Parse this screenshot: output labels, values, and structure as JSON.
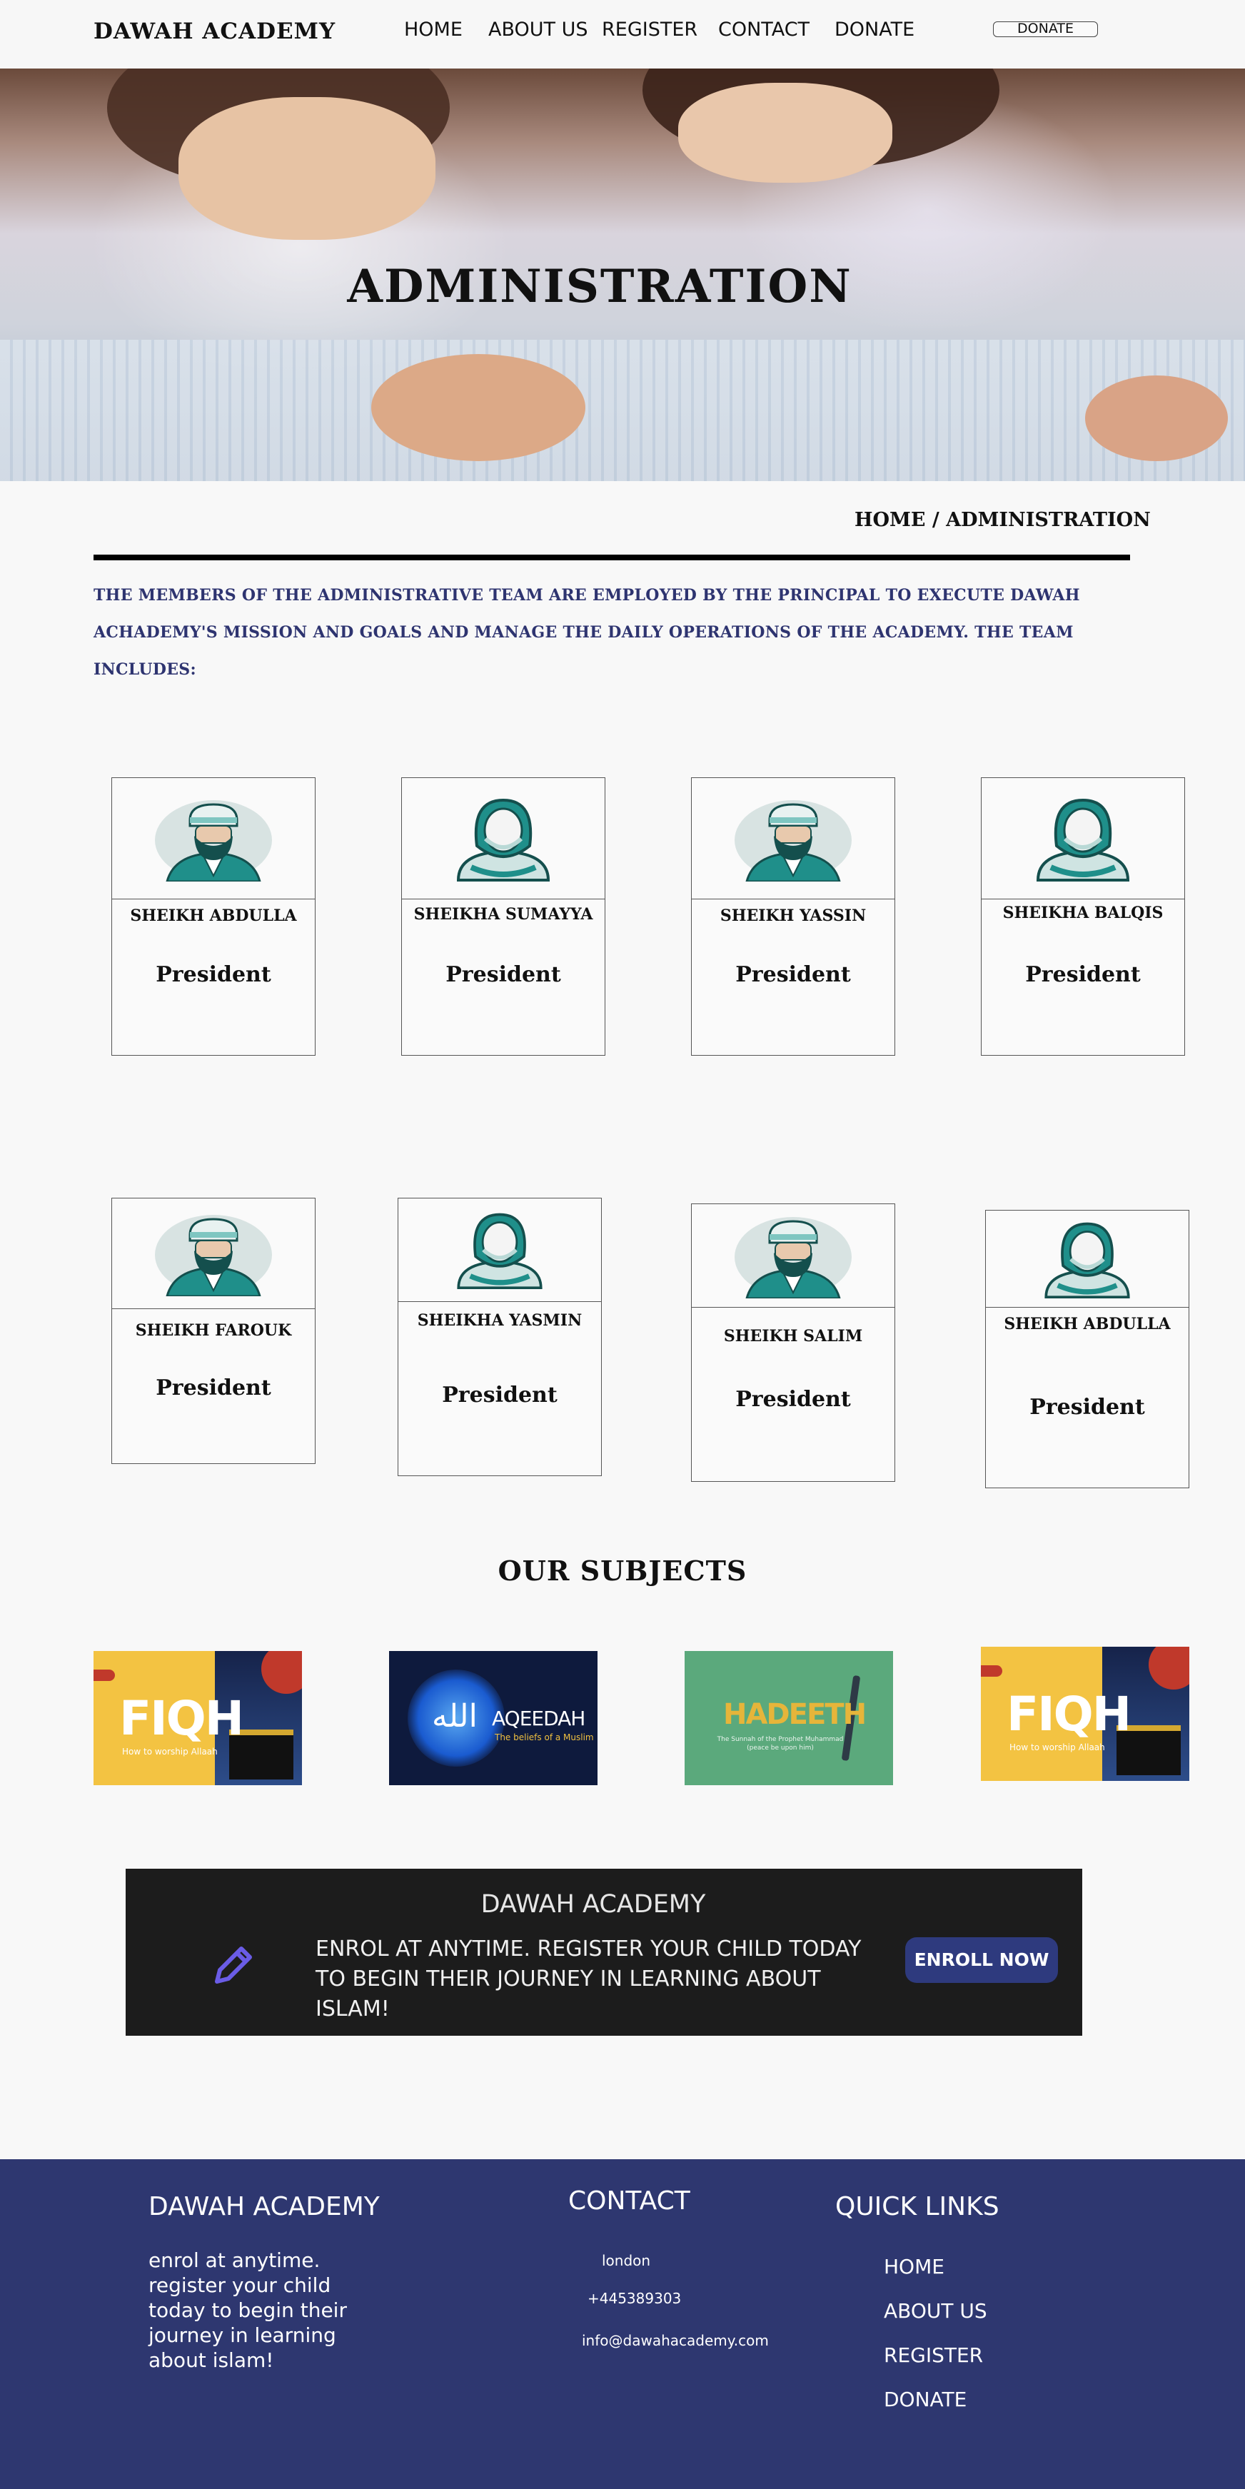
{
  "header": {
    "logo": "DAWAH ACADEMY",
    "nav": [
      "HOME",
      "ABOUT US",
      "REGISTER",
      "CONTACT",
      "DONATE"
    ],
    "donate_button": "DONATE"
  },
  "hero": {
    "title": "ADMINISTRATION"
  },
  "breadcrumb": "HOME / ADMINISTRATION",
  "intro": "THE MEMBERS OF THE ADMINISTRATIVE TEAM ARE EMPLOYED BY THE PRINCIPAL TO EXECUTE DAWAH ACHADEMY'S MISSION AND GOALS AND MANAGE THE DAILY OPERATIONS OF THE ACADEMY. THE TEAM INCLUDES:",
  "team": [
    {
      "name": "SHEIKH ABDULLA",
      "role": "President",
      "avatar": "man-avatar-icon"
    },
    {
      "name": "SHEIKHA SUMAYYA",
      "role": "President",
      "avatar": "woman-avatar-icon"
    },
    {
      "name": "SHEIKH  YASSIN",
      "role": "President",
      "avatar": "man-avatar-icon"
    },
    {
      "name": "SHEIKHA BALQIS",
      "role": "President",
      "avatar": "woman-avatar-icon"
    },
    {
      "name": "SHEIKH FAROUK",
      "role": "President",
      "avatar": "man-avatar-icon"
    },
    {
      "name": "SHEIKHA YASMIN",
      "role": "President",
      "avatar": "woman-avatar-icon"
    },
    {
      "name": "SHEIKH  SALIM",
      "role": "President",
      "avatar": "man-avatar-icon"
    },
    {
      "name": "SHEIKH ABDULLA",
      "role": "President",
      "avatar": "woman-avatar-icon"
    }
  ],
  "subjects": {
    "title": "OUR SUBJECTS",
    "items": [
      {
        "title": "FIQH",
        "subtitle": "How to worship Allaah"
      },
      {
        "title": "AQEEDAH",
        "subtitle": "The beliefs of a Muslim",
        "arabic": "الله"
      },
      {
        "title": "HADEETH",
        "subtitle": "The Sunnah of the Prophet Muhammad (peace be upon him)"
      },
      {
        "title": "FIQH",
        "subtitle": "How to worship Allaah"
      }
    ]
  },
  "cta": {
    "title": "DAWAH ACADEMY",
    "text": "ENROL AT ANYTIME. REGISTER YOUR CHILD TODAY TO BEGIN THEIR JOURNEY IN LEARNING ABOUT ISLAM!",
    "button": "ENROLL NOW",
    "icon": "pencil-icon"
  },
  "footer": {
    "brand": "DAWAH ACADEMY",
    "description": "enrol at anytime. register your child today to begin their journey in learning about islam!",
    "contact_title": "CONTACT",
    "location": "london",
    "phone": "+445389303",
    "email": "info@dawahacademy.com",
    "links_title": "QUICK LINKS",
    "links": [
      "HOME",
      "ABOUT US",
      "REGISTER",
      "DONATE"
    ]
  },
  "colors": {
    "brand_navy": "#2e3770",
    "intro_text": "#2e3470",
    "cta_bg": "#1c1c1c",
    "cta_button": "#2e3a7e",
    "avatar_teal": "#1f8f8a",
    "pencil": "#6a5ce6"
  }
}
